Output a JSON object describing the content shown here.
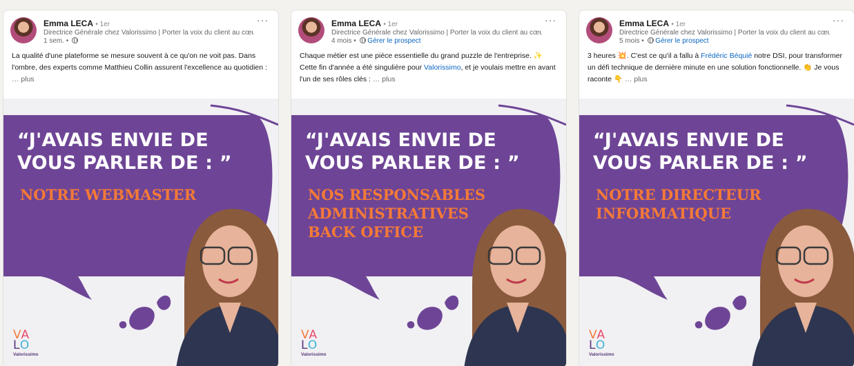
{
  "colors": {
    "bubble": "#6e4596",
    "accent_orange": "#f57a36",
    "link": "#0a66c2"
  },
  "posts": [
    {
      "author": "Emma LECA",
      "degree": "• 1er",
      "headline": "Directrice Générale chez Valorissimo | Porter la voix du client au cœu...",
      "time": "1 sem. •",
      "prospect": "",
      "text_parts": [
        "La qualité d'une plateforme se mesure souvent à ce qu'on ne voit pas. Dans l'ombre, des experts comme Matthieu Collin assurent l'excellence au quotidien : "
      ],
      "plus": " … plus",
      "quote": "“J'AVAIS ENVIE DE VOUS PARLER DE : ”",
      "subject": "NOTRE WEBMASTER",
      "logo_word": "Valorissimo"
    },
    {
      "author": "Emma LECA",
      "degree": "• 1er",
      "headline": "Directrice Générale chez Valorissimo | Porter la voix du client au cœu...",
      "time": "4 mois •",
      "prospect": "Gérer le prospect",
      "text_a": "Chaque métier est une pièce essentielle du grand puzzle de l'entreprise. ✨ Cette fin d'année a été singulière pour ",
      "mention": "Valorissimo",
      "text_b": ", et je voulais mettre en avant l'un de ses rôles clés : ",
      "plus": " … plus",
      "quote": "“J'AVAIS ENVIE DE VOUS PARLER DE : ”",
      "subject": "NOS RESPONSABLES ADMINISTRATIVES BACK OFFICE",
      "logo_word": "Valorissimo"
    },
    {
      "author": "Emma LECA",
      "degree": "• 1er",
      "headline": "Directrice Générale chez Valorissimo | Porter la voix du client au cœu...",
      "time": "5 mois •",
      "prospect": "Gérer le prospect",
      "text_a": "3 heures 💥. C'est ce qu'il a fallu à ",
      "mention": "Frédéric Béquié",
      "text_b": " notre DSI, pour transformer un défi technique de dernière minute en une solution fonctionnelle. 👏 Je vous raconte 👇 ",
      "plus": " … plus",
      "quote": "“J'AVAIS ENVIE DE VOUS PARLER DE : ”",
      "subject": "NOTRE DIRECTEUR INFORMATIQUE",
      "logo_word": "Valorissimo"
    }
  ]
}
